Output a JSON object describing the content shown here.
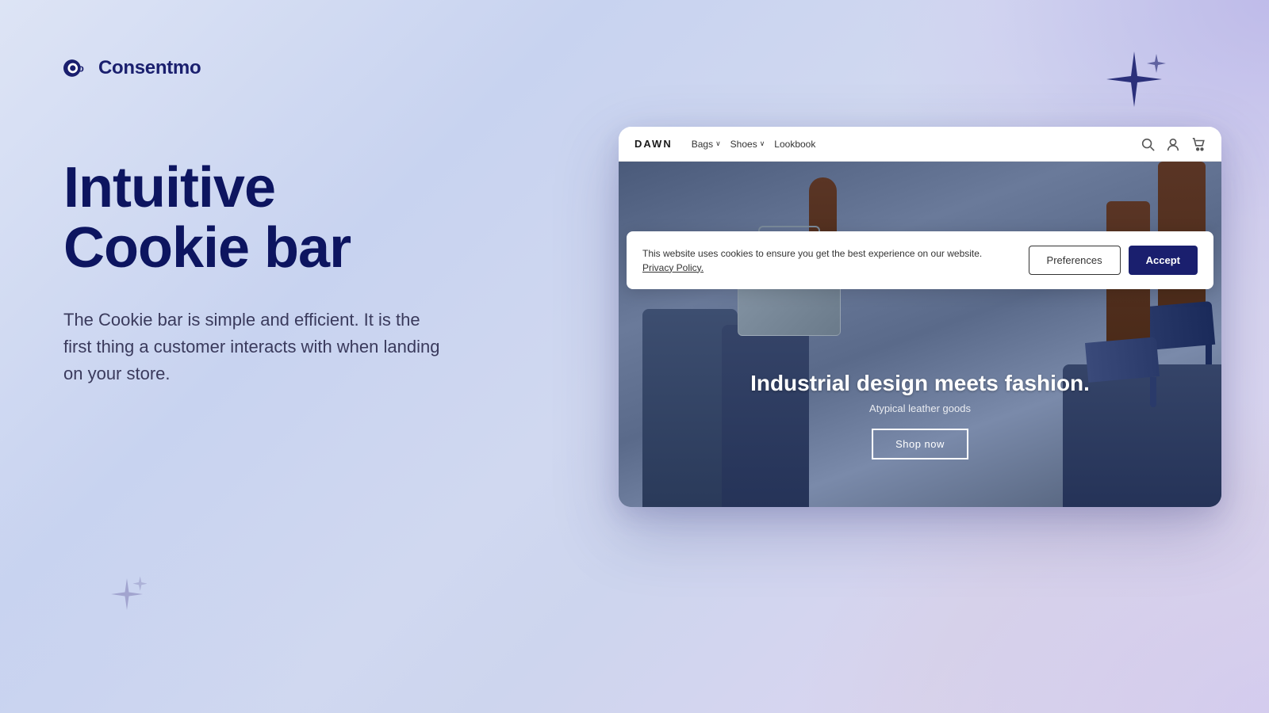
{
  "brand": {
    "logo_text": "Consentmo",
    "logo_icon_alt": "consentmo-logo"
  },
  "left": {
    "headline_line1": "Intuitive",
    "headline_line2": "Cookie bar",
    "description": "The Cookie bar is simple and efficient. It is the first thing a customer interacts with when landing on your store."
  },
  "browser": {
    "store_name": "DAWN",
    "nav": {
      "items": [
        {
          "label": "Bags",
          "has_dropdown": true
        },
        {
          "label": "Shoes",
          "has_dropdown": true
        },
        {
          "label": "Lookbook",
          "has_dropdown": false
        }
      ]
    },
    "hero": {
      "headline": "Industrial design meets fashion.",
      "subtext": "Atypical leather goods",
      "cta_label": "Shop now"
    },
    "cookie_bar": {
      "message": "This website uses cookies to ensure you get the best experience on our website.",
      "privacy_policy_label": "Privacy Policy.",
      "preferences_label": "Preferences",
      "accept_label": "Accept"
    }
  },
  "decorations": {
    "sparkle_top_right_color": "#1a1f6e",
    "sparkle_bottom_left_color": "#9090c0"
  }
}
